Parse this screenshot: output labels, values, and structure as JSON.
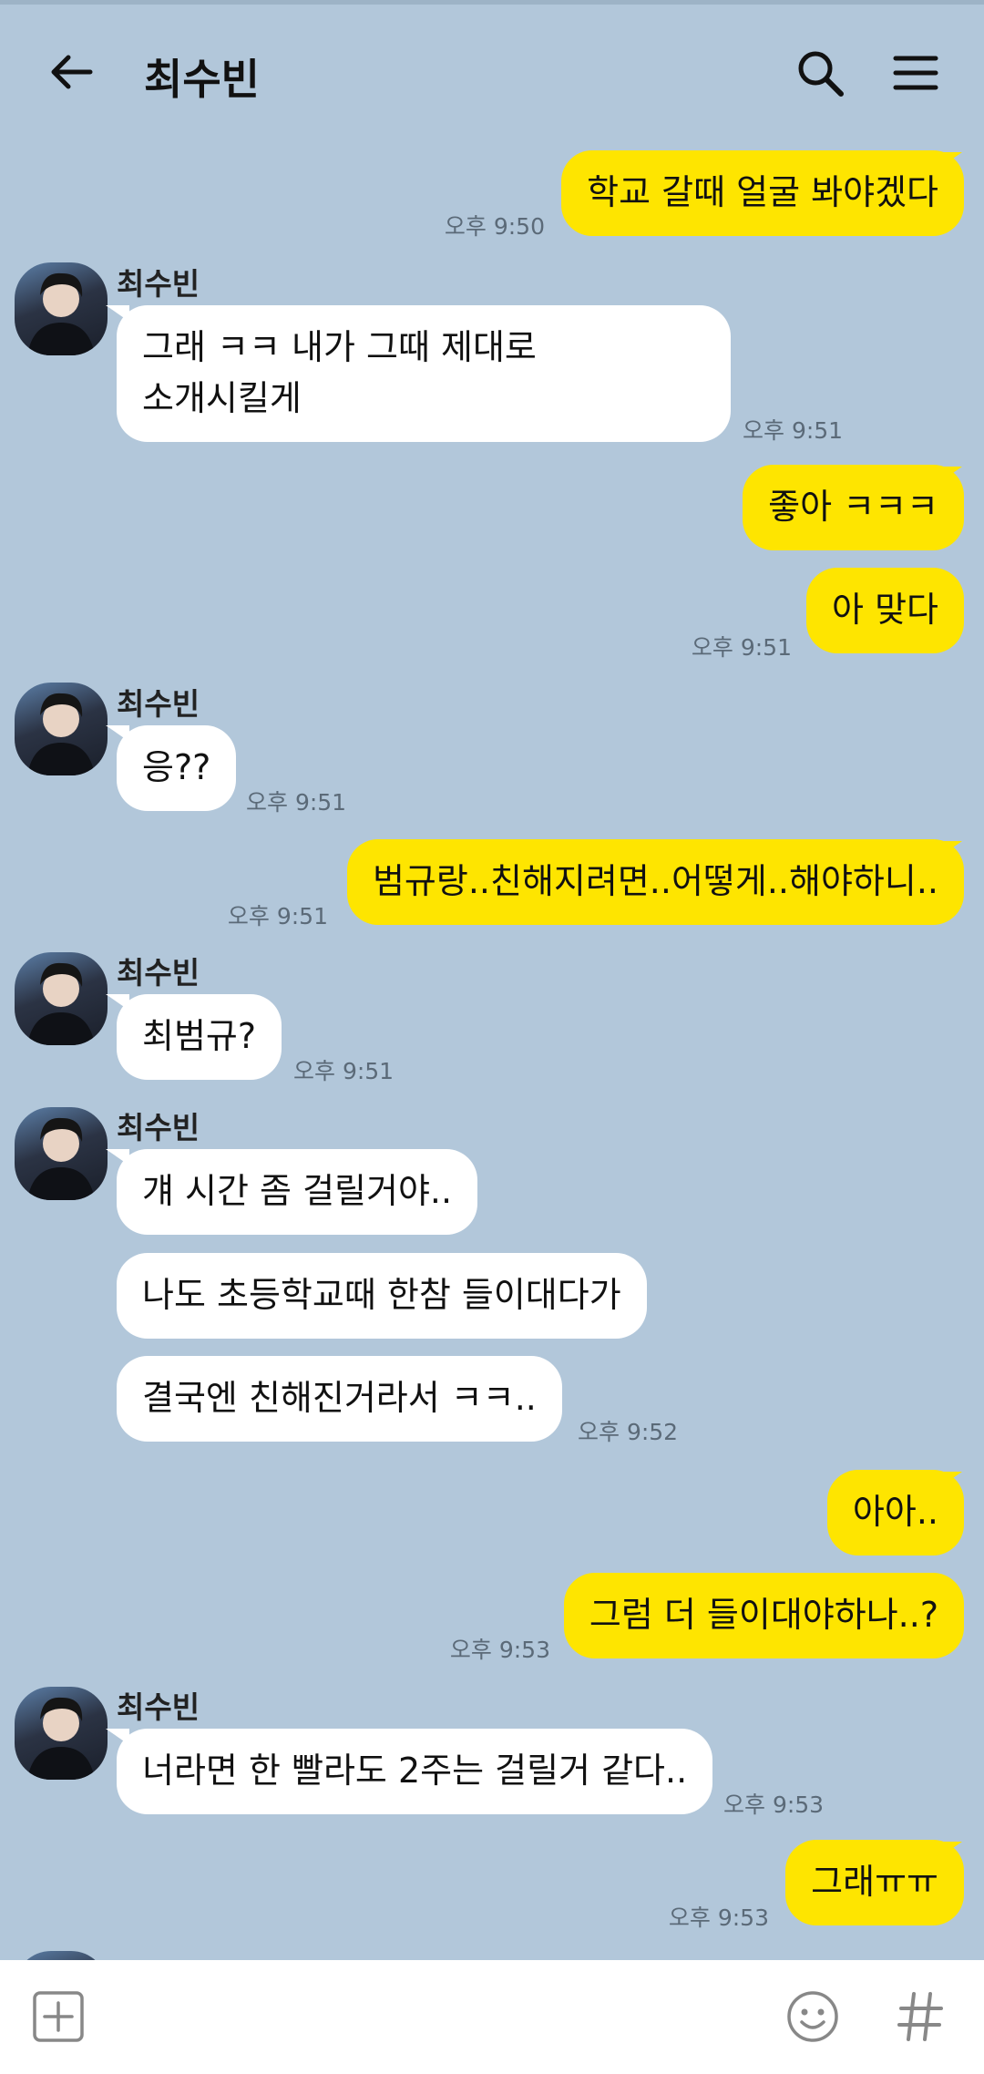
{
  "header": {
    "title": "최수빈",
    "icons": {
      "back": "arrow-left-icon",
      "search": "search-icon",
      "menu": "hamburger-menu-icon"
    }
  },
  "colors": {
    "background": "#b2c7da",
    "my_bubble": "#fee500",
    "other_bubble": "#ffffff"
  },
  "messages": [
    {
      "from": "me",
      "lines": [
        "학교 갈때 얼굴 봐야겠다"
      ],
      "time": "오후 9:50"
    },
    {
      "from": "other",
      "sender": "최수빈",
      "lines": [
        "그래 ㅋㅋ 내가 그때 제대로",
        "소개시킬게"
      ],
      "time": "오후 9:51"
    },
    {
      "from": "me",
      "lines": [
        "좋아 ㅋㅋㅋ"
      ]
    },
    {
      "from": "me",
      "lines": [
        "아 맞다"
      ],
      "time": "오후 9:51"
    },
    {
      "from": "other",
      "sender": "최수빈",
      "lines": [
        "응??"
      ],
      "time": "오후 9:51"
    },
    {
      "from": "me",
      "lines": [
        "범규랑..친해지려면..어떻게..해야하니.."
      ],
      "time": "오후 9:51"
    },
    {
      "from": "other",
      "sender": "최수빈",
      "lines": [
        "최범규?"
      ],
      "time": "오후 9:51"
    },
    {
      "from": "other",
      "sender": "최수빈",
      "lines": [
        "걔 시간 좀 걸릴거야.."
      ]
    },
    {
      "from": "other",
      "lines": [
        "나도 초등학교때 한참 들이대다가"
      ]
    },
    {
      "from": "other",
      "lines": [
        "결국엔 친해진거라서 ㅋㅋ.."
      ],
      "time": "오후 9:52"
    },
    {
      "from": "me",
      "lines": [
        "아아.."
      ]
    },
    {
      "from": "me",
      "lines": [
        "그럼 더 들이대야하나..?"
      ],
      "time": "오후 9:53"
    },
    {
      "from": "other",
      "sender": "최수빈",
      "lines": [
        "너라면 한 빨라도 2주는 걸릴거 같다.."
      ],
      "time": "오후 9:53"
    },
    {
      "from": "me",
      "lines": [
        "그래ㅠㅠ"
      ],
      "time": "오후 9:53"
    }
  ],
  "input_bar": {
    "icons": {
      "attach": "plus-box-icon",
      "emoji": "smiley-icon",
      "hashtag": "hashtag-icon"
    }
  }
}
